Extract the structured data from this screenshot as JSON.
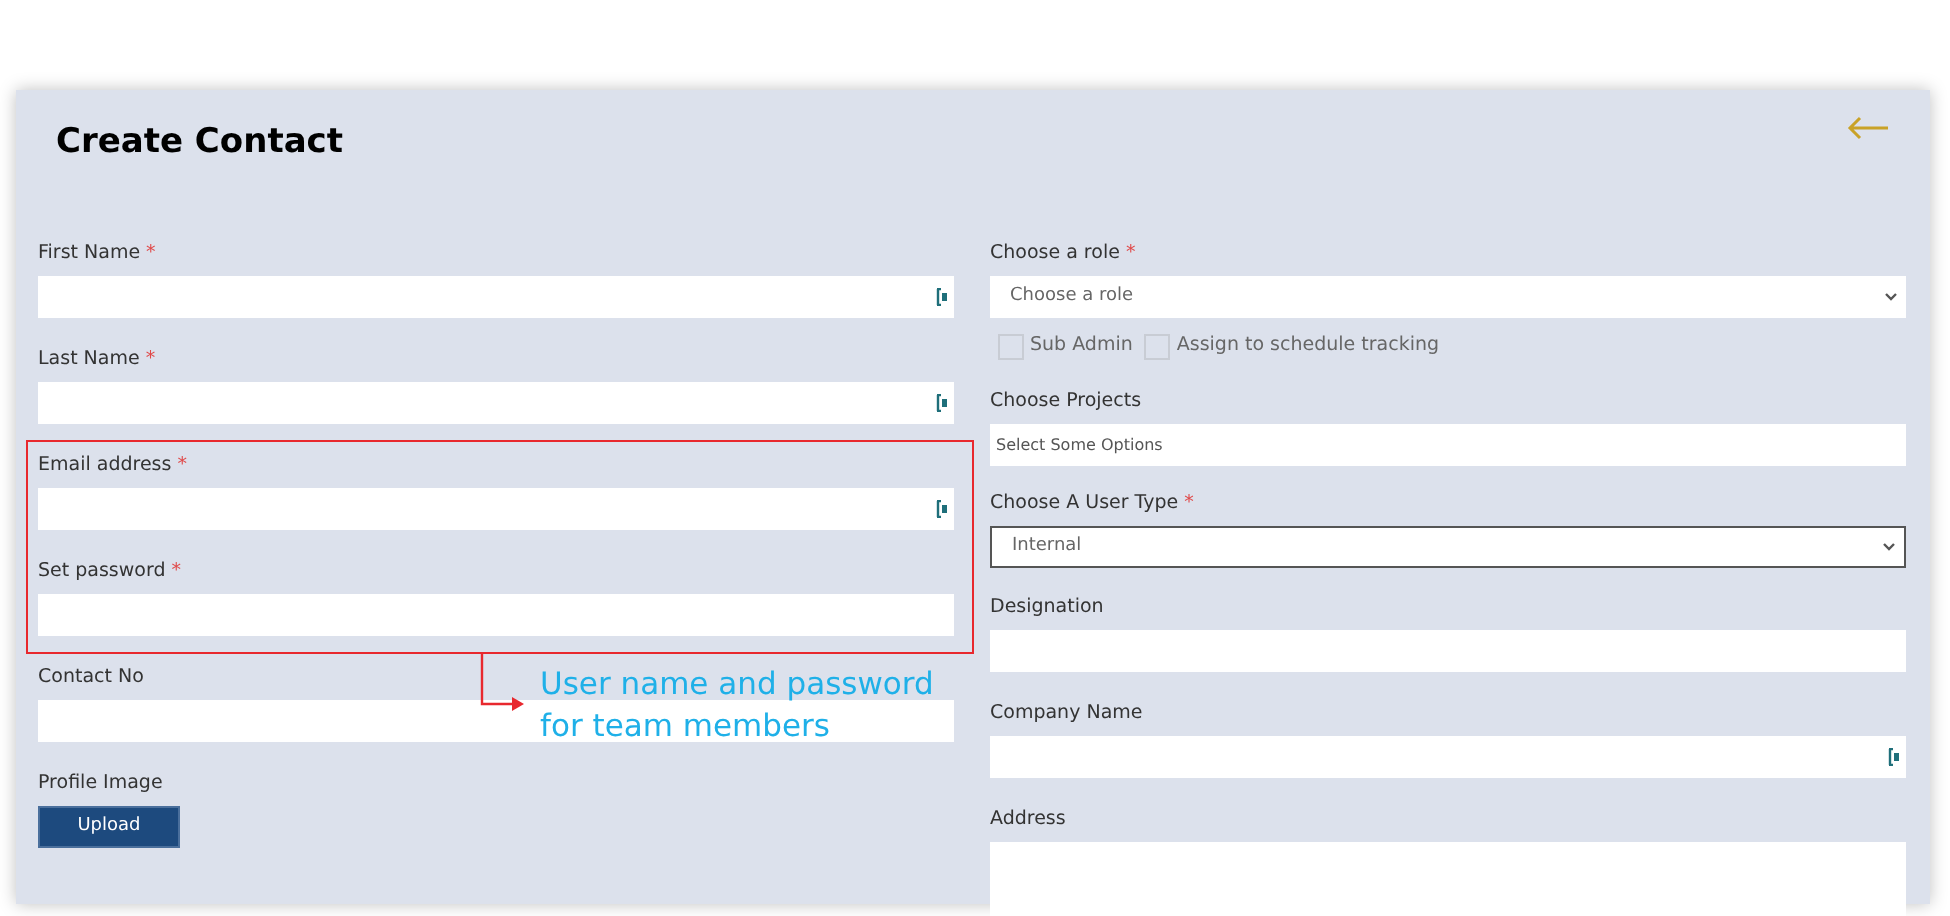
{
  "title": "Create Contact",
  "left_fields": [
    {
      "kind": "text",
      "label": "First Name",
      "required_mark": "*",
      "icon": true
    },
    {
      "kind": "text",
      "label": "Last Name",
      "required_mark": "*",
      "icon": true
    },
    {
      "kind": "text",
      "label": "Email address",
      "required_mark": "*",
      "icon": true
    },
    {
      "kind": "text",
      "label": "Set password",
      "required_mark": "*",
      "icon": false
    },
    {
      "kind": "text",
      "label": "Contact No",
      "icon": false
    },
    {
      "kind": "upload",
      "label": "Profile Image",
      "button": "Upload"
    }
  ],
  "right_fields": [
    {
      "kind": "select",
      "label": "Choose a role",
      "required_mark": "*",
      "value": "Choose a role",
      "focused": false
    },
    {
      "kind": "checkboxes",
      "options": [
        {
          "label": "Sub Admin",
          "checked": false
        },
        {
          "label": "Assign to schedule tracking",
          "checked": false
        }
      ]
    },
    {
      "kind": "multiselect",
      "label": "Choose Projects",
      "placeholder": "Select Some Options"
    },
    {
      "kind": "select",
      "label": "Choose A User Type",
      "required_mark": "*",
      "value": "Internal",
      "focused": true
    },
    {
      "kind": "text",
      "label": "Designation",
      "icon": false
    },
    {
      "kind": "text",
      "label": "Company Name",
      "icon": true
    },
    {
      "kind": "textarea",
      "label": "Address"
    }
  ],
  "annotation": {
    "text": "User name and password for team members"
  }
}
